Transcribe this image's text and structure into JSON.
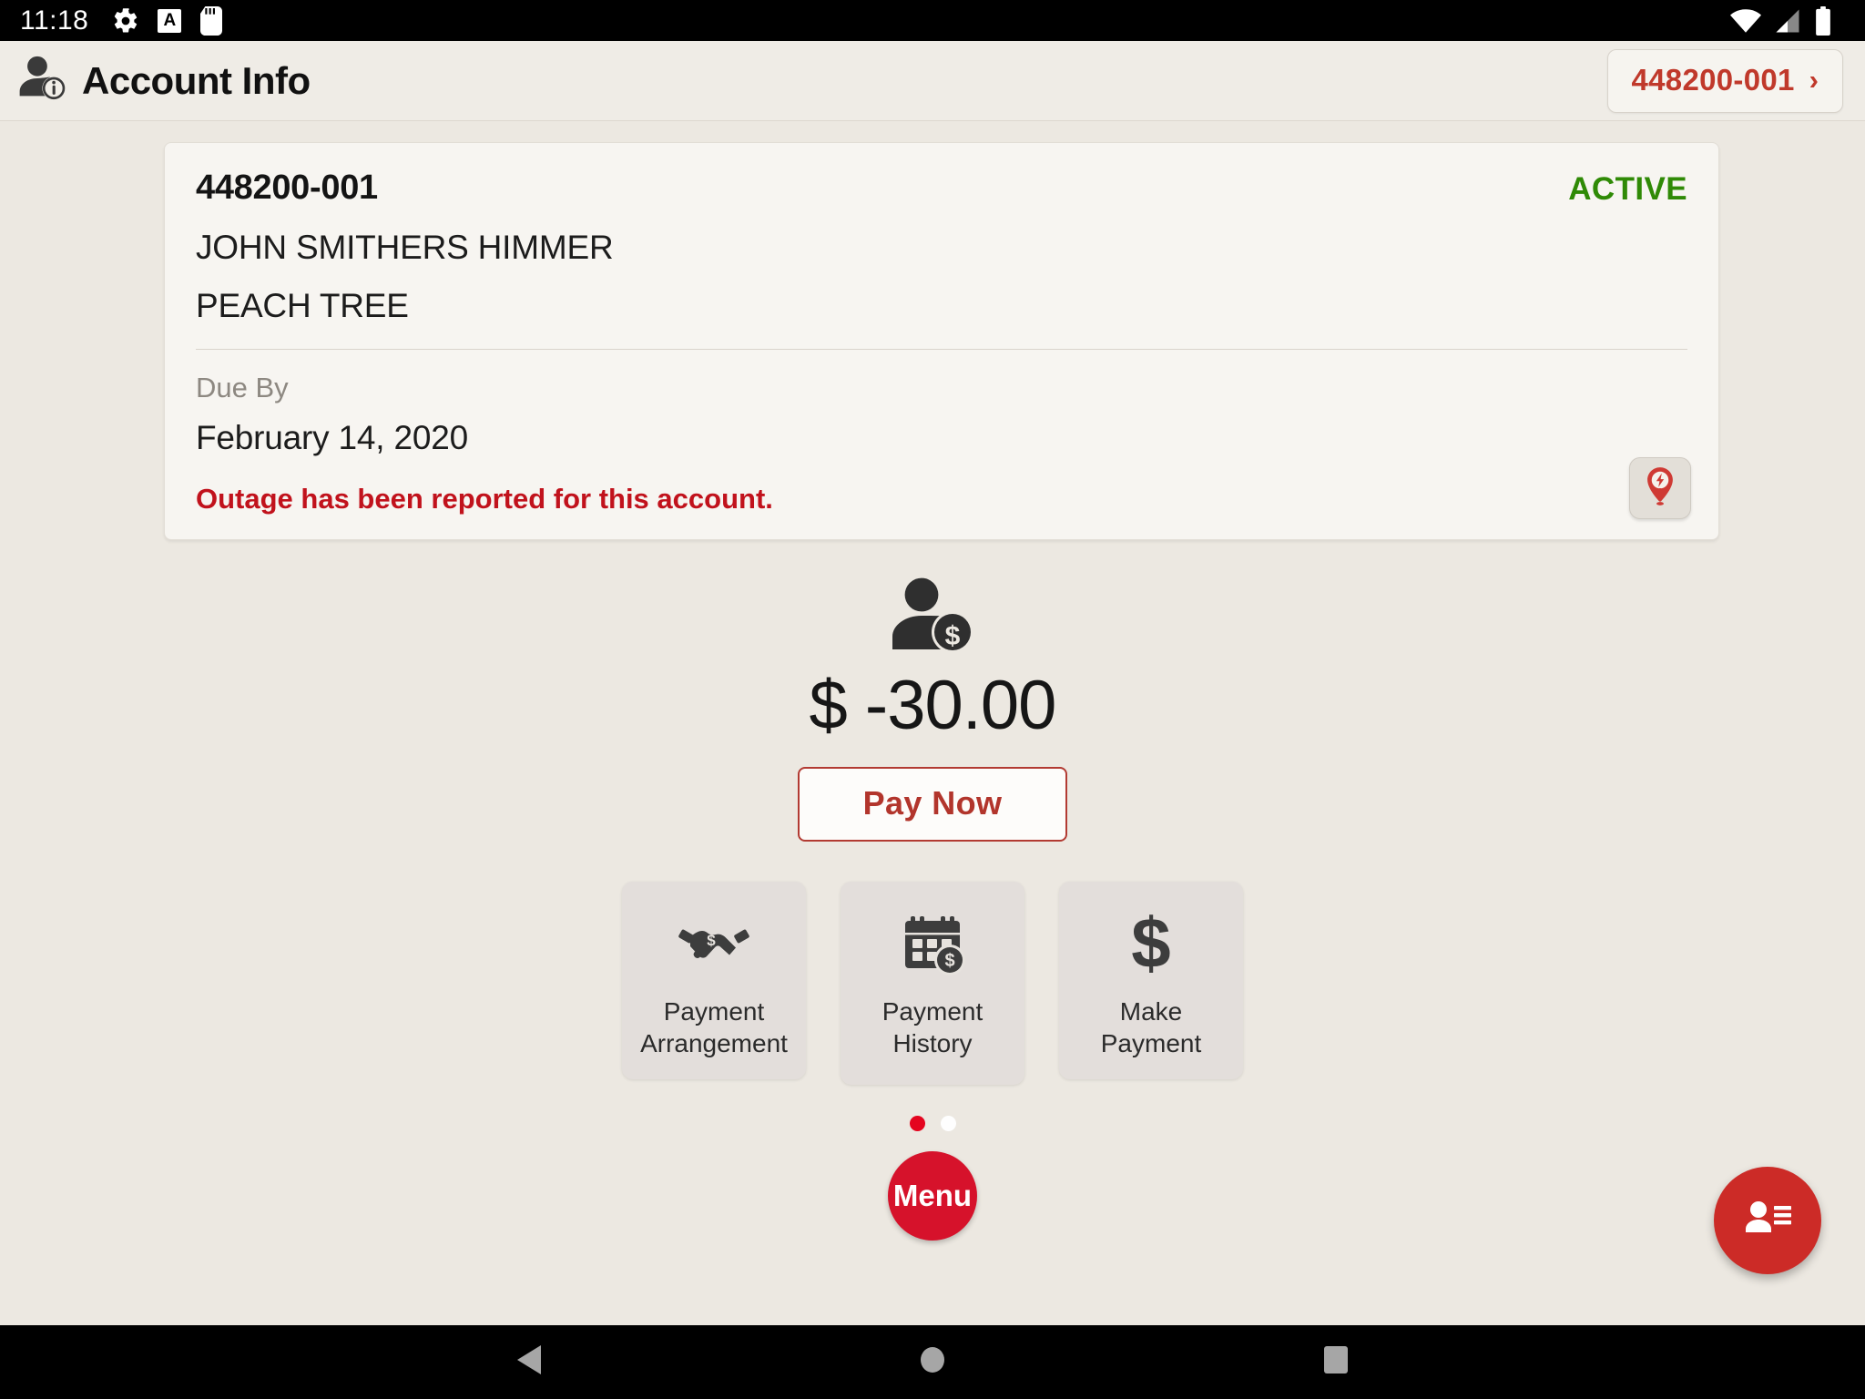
{
  "statusbar": {
    "clock": "11:18",
    "icons_left": [
      "gear-icon",
      "a-box-icon",
      "sd-card-icon"
    ],
    "icons_right": [
      "wifi-icon",
      "cellular-signal-icon",
      "battery-icon"
    ]
  },
  "appbar": {
    "icon": "account-info-icon",
    "title": "Account Info",
    "account_chip": {
      "number": "448200-001",
      "chevron": "›"
    }
  },
  "card": {
    "account_number": "448200-001",
    "status": "ACTIVE",
    "status_color": "#2f8a06",
    "customer_name": "JOHN SMITHERS HIMMER",
    "address": "PEACH TREE",
    "due_label": "Due By",
    "due_date": "February 14, 2020",
    "outage_message": "Outage has been reported for this account.",
    "outage_color": "#c1121c",
    "outage_button_icon": "outage-pin-icon"
  },
  "balance": {
    "icon": "person-dollar-icon",
    "amount": "$ -30.00",
    "pay_now_label": "Pay Now",
    "accent_color": "#b2352c"
  },
  "tiles": [
    {
      "icon": "handshake-dollar-icon",
      "label": "Payment\nArrangement",
      "line1": "Payment",
      "line2": "Arrangement"
    },
    {
      "icon": "calendar-dollar-icon",
      "label": "Payment\nHistory",
      "line1": "Payment",
      "line2": "History"
    },
    {
      "icon": "dollar-sign-icon",
      "label": "Make Payment",
      "line1": "Make Payment",
      "line2": ""
    }
  ],
  "pager": {
    "total": 2,
    "active_index": 0,
    "active_color": "#e4051f",
    "inactive_color": "#ffffff"
  },
  "menu_button": {
    "label": "Menu",
    "color": "#d6122b"
  },
  "fab": {
    "icon": "contact-details-icon",
    "color": "#cc2b27"
  },
  "navbar": {
    "buttons": [
      "back-icon",
      "home-icon",
      "recents-icon"
    ]
  }
}
